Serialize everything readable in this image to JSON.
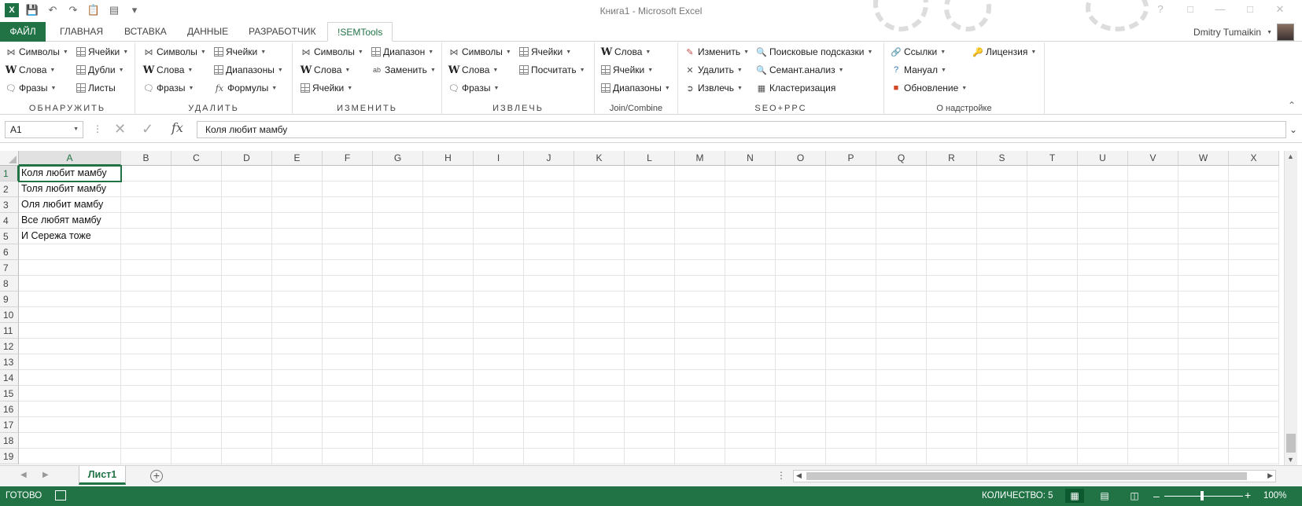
{
  "window": {
    "title": "Книга1 - Microsoft Excel"
  },
  "quick_access": {
    "save_icon": "save-icon",
    "undo_icon": "undo-icon",
    "redo_icon": "redo-icon"
  },
  "tabs": [
    {
      "label": "ФАЙЛ"
    },
    {
      "label": "ГЛАВНАЯ"
    },
    {
      "label": "ВСТАВКА"
    },
    {
      "label": "ДАННЫЕ"
    },
    {
      "label": "РАЗРАБОТЧИК"
    },
    {
      "label": "!SEMTools"
    }
  ],
  "user": {
    "name": "Dmitry Tumaikin"
  },
  "ribbon": {
    "g1": {
      "title": "ОБНАРУЖИТЬ",
      "symbols": "Символы",
      "words": "Слова",
      "phrases": "Фразы",
      "cells": "Ячейки",
      "dupes": "Дубли",
      "sheets": "Листы"
    },
    "g2": {
      "title": "УДАЛИТЬ",
      "symbols": "Символы",
      "words": "Слова",
      "phrases": "Фразы",
      "cells": "Ячейки",
      "ranges": "Диапазоны",
      "formulas": "Формулы"
    },
    "g3": {
      "title": "ИЗМЕНИТЬ",
      "symbols": "Символы",
      "words": "Слова",
      "cells": "Ячейки",
      "range": "Диапазон",
      "replace": "Заменить"
    },
    "g4": {
      "title": "ИЗВЛЕЧЬ",
      "symbols": "Символы",
      "words": "Слова",
      "phrases": "Фразы",
      "cells": "Ячейки",
      "count": "Посчитать"
    },
    "g5": {
      "title": "Join/Combine",
      "words": "Слова",
      "cells": "Ячейки",
      "ranges": "Диапазоны"
    },
    "g6": {
      "title": "SEO+PPC",
      "change": "Изменить",
      "delete": "Удалить",
      "extract": "Извлечь",
      "suggest": "Поисковые подсказки",
      "semantic": "Семант.анализ",
      "cluster": "Кластеризация"
    },
    "g7": {
      "title": "О надстройке",
      "links": "Ссылки",
      "manual": "Мануал",
      "update": "Обновление",
      "license": "Лицензия"
    }
  },
  "formula_bar": {
    "name_box": "A1",
    "formula": "Коля любит мамбу"
  },
  "grid": {
    "columns": [
      "A",
      "B",
      "C",
      "D",
      "E",
      "F",
      "G",
      "H",
      "I",
      "J",
      "K",
      "L",
      "M",
      "N",
      "O",
      "P",
      "Q",
      "R",
      "S",
      "T",
      "U",
      "V",
      "W",
      "X"
    ],
    "rows": [
      "1",
      "2",
      "3",
      "4",
      "5",
      "6",
      "7",
      "8",
      "9",
      "10",
      "11",
      "12",
      "13",
      "14",
      "15",
      "16",
      "17",
      "18",
      "19"
    ],
    "cells_A": [
      "Коля любит мамбу",
      "Толя любит мамбу",
      "Оля любит мамбу",
      "Все любят мамбу",
      "И Сережа тоже"
    ]
  },
  "sheets": {
    "active": "Лист1"
  },
  "status": {
    "ready": "ГОТОВО",
    "count": "КОЛИЧЕСТВО: 5",
    "zoom": "100%",
    "zoom_fraction": 0.5
  }
}
